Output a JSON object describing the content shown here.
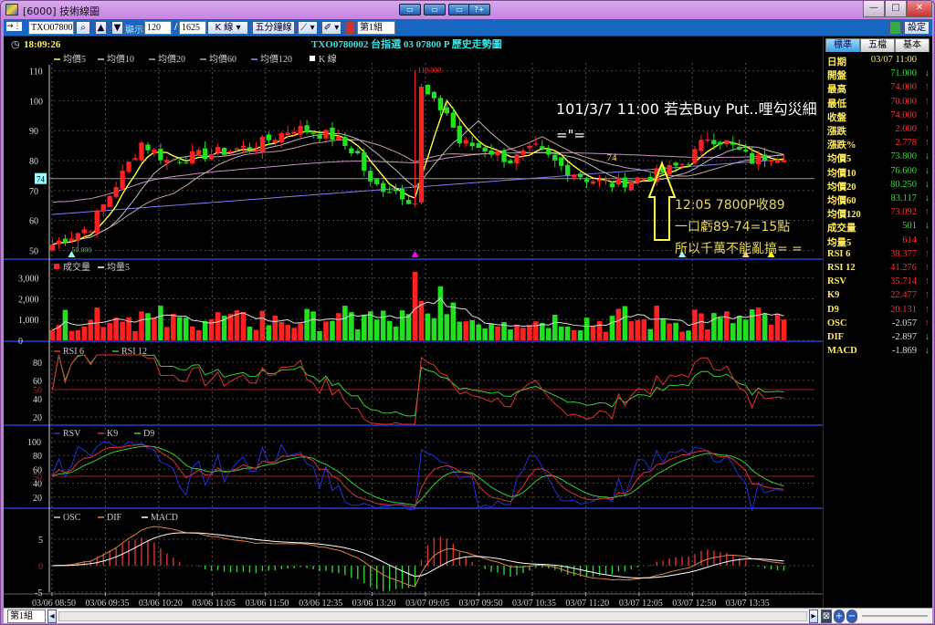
{
  "window": {
    "title": "[6000] 技術線圖",
    "help_button": "?+",
    "minimize": "—",
    "maximize": "□",
    "close": "✕"
  },
  "toolbar": {
    "symbol": "TXO07800",
    "display_label": "顯示",
    "display_count": "120",
    "total_count": "1625",
    "chart_type": "K 線 ▾",
    "period": "五分鐘線 ▾",
    "draw_tool": "⟋ ▾",
    "eraser_tool": "✐ ▾",
    "group": "第1組",
    "settings": "設定",
    "nav_arrow": "→⋮"
  },
  "header": {
    "time": "18:09:26",
    "instrument_title": "TXO0780002 台指選 03 07800 P   歷史走勢圖"
  },
  "legends": {
    "price": [
      {
        "label": "均價5",
        "color": "#ffff40"
      },
      {
        "label": "均價10",
        "color": "#d0d0d0"
      },
      {
        "label": "均價20",
        "color": "#c8a0a0"
      },
      {
        "label": "均價60",
        "color": "#c890c8"
      },
      {
        "label": "均價120",
        "color": "#9090ff"
      },
      {
        "label": "K 線",
        "color": "#ffffff"
      }
    ],
    "volume": [
      {
        "label": "成交量",
        "color": "#ff2020"
      },
      {
        "label": "均量5",
        "color": "#ffffff"
      }
    ],
    "rsi": [
      {
        "label": "RSI 6",
        "color": "#e03030"
      },
      {
        "label": "RSI 12",
        "color": "#30d030"
      }
    ],
    "kd": [
      {
        "label": "RSV",
        "color": "#2030e0"
      },
      {
        "label": "K9",
        "color": "#e03030"
      },
      {
        "label": "D9",
        "color": "#30d030"
      }
    ],
    "macd": [
      {
        "label": "OSC",
        "color": "#cccccc"
      },
      {
        "label": "DIF",
        "color": "#e08040"
      },
      {
        "label": "MACD",
        "color": "#ffffff"
      }
    ]
  },
  "annotations": {
    "line1": "101/3/7 11:00 若去Buy Put..哩勾災細",
    "line2": "=\"=",
    "note1": "12:05 7800P收89",
    "note2": "一口虧89-74=15點",
    "note3": "所以千萬不能亂搞= =",
    "price_marker": "74",
    "high_label": "110.000",
    "low_label": "50.000",
    "current_price_box": "74"
  },
  "chart_data": {
    "type": "candlestick",
    "price_axis": {
      "ticks": [
        110,
        100,
        90,
        80,
        70,
        60,
        50
      ],
      "range": [
        48,
        112
      ]
    },
    "volume_axis": {
      "ticks": [
        "3,000",
        "2,000",
        "1,000",
        "0"
      ],
      "range": [
        0,
        3600
      ]
    },
    "rsi_axis": {
      "ticks": [
        80,
        60,
        50,
        40,
        20
      ],
      "range": [
        10,
        90
      ]
    },
    "kd_axis": {
      "ticks": [
        100,
        80,
        60,
        50,
        40,
        20
      ],
      "range": [
        0,
        105
      ]
    },
    "macd_axis": {
      "ticks": [
        5,
        0,
        -5
      ],
      "range": [
        -5.5,
        9
      ]
    },
    "x_labels": [
      "03/06 08:50",
      "03/06 09:35",
      "03/06 10:20",
      "03/06 11:05",
      "03/06 11:50",
      "03/06 12:35",
      "03/06 13:20",
      "03/07 09:05",
      "03/07 09:50",
      "03/07 10:35",
      "03/07 11:20",
      "03/07 12:05",
      "03/07 12:50",
      "03/07 13:35"
    ],
    "bar_count": 116,
    "close_keypoints": [
      [
        0,
        52
      ],
      [
        6,
        58
      ],
      [
        10,
        72
      ],
      [
        14,
        86
      ],
      [
        18,
        80
      ],
      [
        24,
        82
      ],
      [
        32,
        85
      ],
      [
        38,
        91
      ],
      [
        44,
        88
      ],
      [
        48,
        82
      ],
      [
        50,
        72
      ],
      [
        54,
        70
      ],
      [
        57,
        66
      ],
      [
        58,
        104
      ],
      [
        60,
        99
      ],
      [
        62,
        96
      ],
      [
        64,
        86
      ],
      [
        68,
        84
      ],
      [
        72,
        80
      ],
      [
        76,
        84
      ],
      [
        80,
        78
      ],
      [
        84,
        74
      ],
      [
        88,
        72
      ],
      [
        92,
        74
      ],
      [
        96,
        76
      ],
      [
        100,
        80
      ],
      [
        103,
        88
      ],
      [
        106,
        86
      ],
      [
        110,
        80
      ],
      [
        113,
        82
      ],
      [
        115,
        82
      ]
    ],
    "volume_peaks": [
      [
        57,
        3300
      ],
      [
        61,
        2600
      ],
      [
        58,
        1900
      ]
    ]
  },
  "sidebar": {
    "tabs": [
      "標準",
      "五檔",
      "基本"
    ],
    "rows": [
      {
        "k": "日期",
        "v": "03/07 11:00",
        "c": "#ffea60",
        "a": ""
      },
      {
        "k": "開盤",
        "v": "71.000",
        "c": "#30e030",
        "a": "↓"
      },
      {
        "k": "最高",
        "v": "74.000",
        "c": "#ff3030",
        "a": "↑"
      },
      {
        "k": "最低",
        "v": "70.000",
        "c": "#ff3030",
        "a": "↑"
      },
      {
        "k": "收盤",
        "v": "74.000",
        "c": "#ff3030",
        "a": "↑"
      },
      {
        "k": "漲跌",
        "v": "2.000",
        "c": "#ff3030",
        "a": "↑"
      },
      {
        "k": "漲跌%",
        "v": "2.778",
        "c": "#ff3030",
        "a": "↑"
      },
      {
        "k": "均價5",
        "v": "73.800",
        "c": "#30e030",
        "a": "↓"
      },
      {
        "k": "均價10",
        "v": "76.600",
        "c": "#30e030",
        "a": "↓"
      },
      {
        "k": "均價20",
        "v": "80.250",
        "c": "#30e030",
        "a": "↓"
      },
      {
        "k": "均價60",
        "v": "83.117",
        "c": "#30e030",
        "a": "↓"
      },
      {
        "k": "均價120",
        "v": "73.092",
        "c": "#ff3030",
        "a": "↑"
      },
      {
        "k": "成交量",
        "v": "501",
        "c": "#30e030",
        "a": "↓"
      },
      {
        "k": "均量5",
        "v": "614",
        "c": "#ff3030",
        "a": "↑"
      },
      {
        "k": "RSI 6",
        "v": "38.377",
        "c": "#ff3030",
        "a": "↑"
      },
      {
        "k": "RSI 12",
        "v": "41.276",
        "c": "#ff3030",
        "a": "↑"
      },
      {
        "k": "RSV",
        "v": "35.714",
        "c": "#ff3030",
        "a": "↑"
      },
      {
        "k": "K9",
        "v": "22.477",
        "c": "#ff3030",
        "a": "↑"
      },
      {
        "k": "D9",
        "v": "20.131",
        "c": "#ff3030",
        "a": "↑"
      },
      {
        "k": "OSC",
        "v": "-2.057",
        "c": "#dddddd",
        "a": "↑"
      },
      {
        "k": "DIF",
        "v": "-2.897",
        "c": "#dddddd",
        "a": "↓"
      },
      {
        "k": "MACD",
        "v": "-1.869",
        "c": "#dddddd",
        "a": "↓"
      }
    ]
  },
  "bottom": {
    "group": "第1組",
    "scroll_left": "◂",
    "scroll_right": "▸",
    "zoom_in": "+",
    "zoom_out": "−"
  }
}
